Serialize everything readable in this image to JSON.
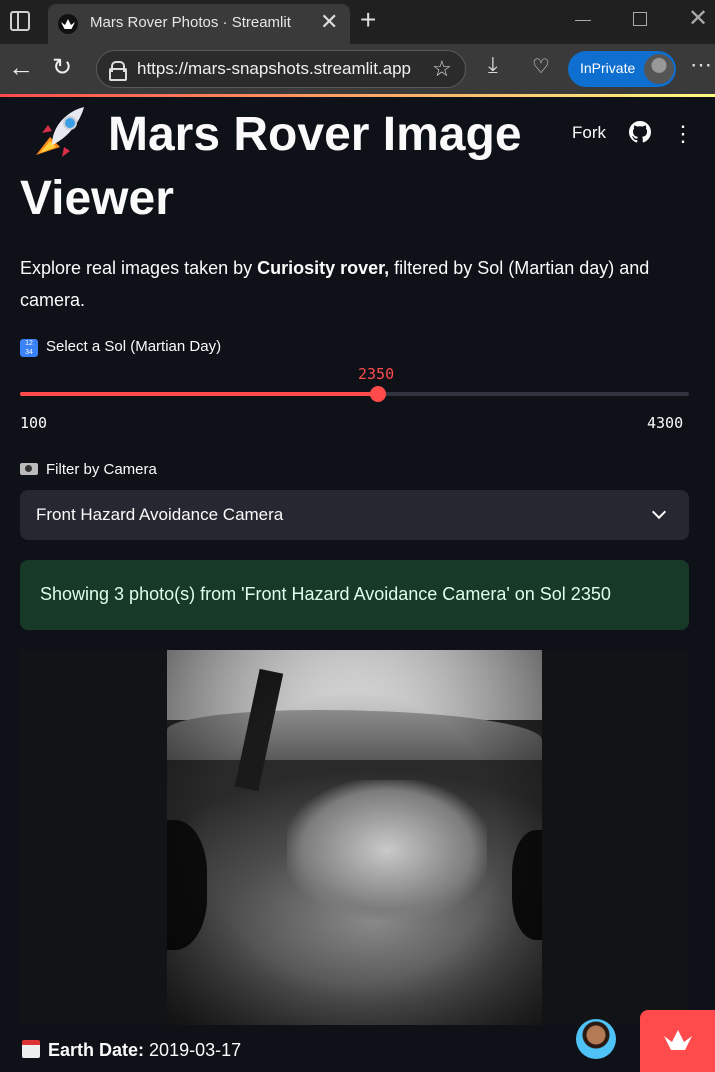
{
  "browser": {
    "tab_title": "Mars Rover Photos · Streamlit",
    "url": "https://mars-snapshots.streamlit.app",
    "inprivate_label": "InPrivate"
  },
  "header": {
    "title_emoji": "🚀",
    "title": "Mars Rover Image Viewer",
    "fork_label": "Fork"
  },
  "intro": {
    "prefix": "Explore real images taken by ",
    "rover": "Curiosity rover,",
    "suffix": " filtered by Sol (Martian day) and camera."
  },
  "sol_slider": {
    "label": "Select a Sol (Martian Day)",
    "value": "2350",
    "min": "100",
    "max": "4300",
    "fraction": 0.5357
  },
  "camera_filter": {
    "label": "Filter by Camera",
    "selected": "Front Hazard Avoidance Camera"
  },
  "status": {
    "message": "Showing 3 photo(s) from 'Front Hazard Avoidance Camera' on Sol 2350"
  },
  "photo": {
    "earth_date_label": "Earth Date:",
    "earth_date": "2019-03-17"
  },
  "colors": {
    "accent": "#ff4b4b",
    "background": "#0e1117",
    "success_bg": "#173928"
  }
}
